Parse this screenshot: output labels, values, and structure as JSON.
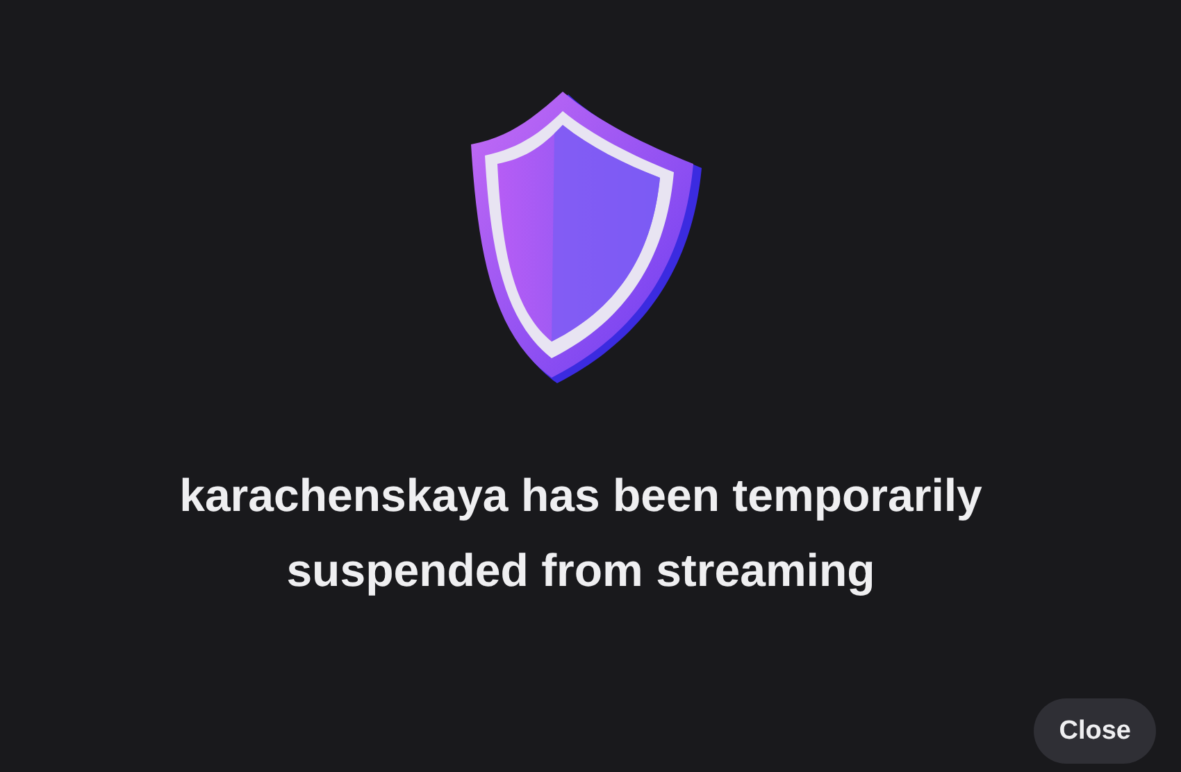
{
  "message": "karachenskaya has been temporarily suspended from streaming",
  "buttons": [
    {
      "label": "Close"
    }
  ]
}
